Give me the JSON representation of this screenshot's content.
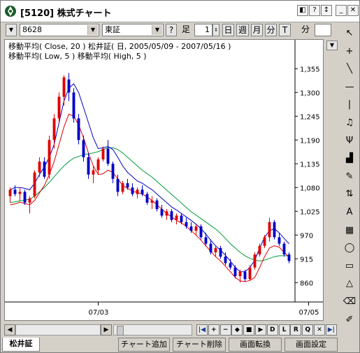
{
  "window": {
    "title": "[5120] 株式チャート"
  },
  "toolbar": {
    "code": "8628",
    "market": "東証",
    "help": "?",
    "period_label": "足",
    "period_value": "1",
    "buttons": [
      "日",
      "週",
      "月",
      "分",
      "T"
    ],
    "minute_label": "分"
  },
  "chart": {
    "legend_line1": "移動平均( Close, 20 )   松井証( 日, 2005/05/09 - 2007/05/16 )",
    "legend_line2": "移動平均( Low, 5 )   移動平均( High, 5 )",
    "colors": {
      "up": "#e00000",
      "down": "#0000c8",
      "ma_close": "#009a3a",
      "ma_low": "#e00000",
      "ma_high": "#0000c8"
    }
  },
  "chart_data": {
    "type": "candlestick",
    "title": "松井証( 日, 2005/05/09 - 2007/05/16 )",
    "yticks": [
      "1,355",
      "1,300",
      "1,245",
      "1,190",
      "1,135",
      "1,080",
      "1,025",
      "970",
      "915",
      "860"
    ],
    "ytick_values": [
      1355,
      1300,
      1245,
      1190,
      1135,
      1080,
      1025,
      970,
      915,
      860
    ],
    "ylim": [
      820,
      1370
    ],
    "xticks": [
      "07/03",
      "07/05"
    ],
    "xtick_index": [
      18,
      61
    ],
    "candles": [
      {
        "o": 1060,
        "h": 1080,
        "l": 1045,
        "c": 1075
      },
      {
        "o": 1075,
        "h": 1085,
        "l": 1060,
        "c": 1065
      },
      {
        "o": 1065,
        "h": 1080,
        "l": 1050,
        "c": 1070
      },
      {
        "o": 1070,
        "h": 1075,
        "l": 1040,
        "c": 1045
      },
      {
        "o": 1045,
        "h": 1060,
        "l": 1020,
        "c": 1055
      },
      {
        "o": 1060,
        "h": 1120,
        "l": 1055,
        "c": 1115
      },
      {
        "o": 1115,
        "h": 1150,
        "l": 1105,
        "c": 1140
      },
      {
        "o": 1140,
        "h": 1150,
        "l": 1100,
        "c": 1105
      },
      {
        "o": 1110,
        "h": 1200,
        "l": 1100,
        "c": 1190
      },
      {
        "o": 1190,
        "h": 1250,
        "l": 1170,
        "c": 1240
      },
      {
        "o": 1240,
        "h": 1300,
        "l": 1230,
        "c": 1290
      },
      {
        "o": 1290,
        "h": 1340,
        "l": 1270,
        "c": 1335
      },
      {
        "o": 1330,
        "h": 1345,
        "l": 1280,
        "c": 1300
      },
      {
        "o": 1300,
        "h": 1310,
        "l": 1230,
        "c": 1240
      },
      {
        "o": 1240,
        "h": 1250,
        "l": 1180,
        "c": 1190
      },
      {
        "o": 1190,
        "h": 1200,
        "l": 1140,
        "c": 1150
      },
      {
        "o": 1150,
        "h": 1160,
        "l": 1100,
        "c": 1110
      },
      {
        "o": 1110,
        "h": 1130,
        "l": 1090,
        "c": 1120
      },
      {
        "o": 1120,
        "h": 1150,
        "l": 1110,
        "c": 1145
      },
      {
        "o": 1145,
        "h": 1175,
        "l": 1140,
        "c": 1170
      },
      {
        "o": 1170,
        "h": 1190,
        "l": 1130,
        "c": 1135
      },
      {
        "o": 1135,
        "h": 1140,
        "l": 1090,
        "c": 1100
      },
      {
        "o": 1100,
        "h": 1110,
        "l": 1060,
        "c": 1070
      },
      {
        "o": 1070,
        "h": 1095,
        "l": 1065,
        "c": 1090
      },
      {
        "o": 1090,
        "h": 1100,
        "l": 1075,
        "c": 1080
      },
      {
        "o": 1080,
        "h": 1090,
        "l": 1060,
        "c": 1065
      },
      {
        "o": 1065,
        "h": 1080,
        "l": 1055,
        "c": 1075
      },
      {
        "o": 1075,
        "h": 1085,
        "l": 1060,
        "c": 1065
      },
      {
        "o": 1065,
        "h": 1070,
        "l": 1040,
        "c": 1045
      },
      {
        "o": 1045,
        "h": 1060,
        "l": 1030,
        "c": 1050
      },
      {
        "o": 1050,
        "h": 1055,
        "l": 1025,
        "c": 1030
      },
      {
        "o": 1030,
        "h": 1040,
        "l": 1010,
        "c": 1015
      },
      {
        "o": 1015,
        "h": 1030,
        "l": 1005,
        "c": 1025
      },
      {
        "o": 1025,
        "h": 1030,
        "l": 1000,
        "c": 1005
      },
      {
        "o": 1005,
        "h": 1020,
        "l": 995,
        "c": 1015
      },
      {
        "o": 1015,
        "h": 1020,
        "l": 995,
        "c": 1000
      },
      {
        "o": 1000,
        "h": 1010,
        "l": 985,
        "c": 990
      },
      {
        "o": 990,
        "h": 1000,
        "l": 975,
        "c": 980
      },
      {
        "o": 980,
        "h": 995,
        "l": 970,
        "c": 990
      },
      {
        "o": 990,
        "h": 995,
        "l": 960,
        "c": 965
      },
      {
        "o": 965,
        "h": 975,
        "l": 945,
        "c": 950
      },
      {
        "o": 950,
        "h": 960,
        "l": 925,
        "c": 930
      },
      {
        "o": 930,
        "h": 945,
        "l": 920,
        "c": 940
      },
      {
        "o": 940,
        "h": 945,
        "l": 915,
        "c": 920
      },
      {
        "o": 920,
        "h": 930,
        "l": 900,
        "c": 905
      },
      {
        "o": 905,
        "h": 915,
        "l": 890,
        "c": 895
      },
      {
        "o": 895,
        "h": 900,
        "l": 870,
        "c": 875
      },
      {
        "o": 875,
        "h": 890,
        "l": 860,
        "c": 885
      },
      {
        "o": 885,
        "h": 890,
        "l": 862,
        "c": 868
      },
      {
        "o": 868,
        "h": 900,
        "l": 865,
        "c": 895
      },
      {
        "o": 895,
        "h": 930,
        "l": 890,
        "c": 925
      },
      {
        "o": 925,
        "h": 950,
        "l": 920,
        "c": 945
      },
      {
        "o": 945,
        "h": 970,
        "l": 940,
        "c": 965
      },
      {
        "o": 965,
        "h": 1010,
        "l": 955,
        "c": 1000
      },
      {
        "o": 1000,
        "h": 1005,
        "l": 960,
        "c": 965
      },
      {
        "o": 965,
        "h": 975,
        "l": 945,
        "c": 950
      },
      {
        "o": 950,
        "h": 955,
        "l": 920,
        "c": 925
      },
      {
        "o": 925,
        "h": 930,
        "l": 905,
        "c": 910
      }
    ],
    "ma_close20": [
      1045,
      1047,
      1049,
      1051,
      1053,
      1060,
      1070,
      1080,
      1092,
      1105,
      1118,
      1130,
      1140,
      1148,
      1152,
      1156,
      1158,
      1160,
      1163,
      1168,
      1172,
      1172,
      1168,
      1160,
      1150,
      1140,
      1130,
      1120,
      1112,
      1104,
      1094,
      1084,
      1074,
      1064,
      1054,
      1044,
      1034,
      1024,
      1016,
      1008,
      1000,
      992,
      984,
      974,
      962,
      950,
      940,
      930,
      922,
      916,
      912,
      910,
      912,
      916,
      920,
      922,
      922,
      922
    ],
    "ma_low5": [
      1040,
      1042,
      1046,
      1043,
      1040,
      1050,
      1068,
      1085,
      1110,
      1140,
      1180,
      1220,
      1250,
      1245,
      1225,
      1195,
      1160,
      1130,
      1110,
      1112,
      1120,
      1115,
      1100,
      1085,
      1078,
      1072,
      1068,
      1065,
      1058,
      1050,
      1040,
      1030,
      1020,
      1012,
      1004,
      998,
      990,
      980,
      970,
      958,
      945,
      932,
      920,
      910,
      898,
      885,
      872,
      864,
      862,
      865,
      872,
      895,
      920,
      940,
      945,
      942,
      930,
      918
    ],
    "ma_high5": [
      1075,
      1080,
      1080,
      1078,
      1075,
      1090,
      1110,
      1128,
      1150,
      1180,
      1230,
      1280,
      1310,
      1320,
      1300,
      1265,
      1230,
      1195,
      1170,
      1172,
      1175,
      1168,
      1150,
      1130,
      1115,
      1105,
      1095,
      1090,
      1082,
      1075,
      1065,
      1055,
      1045,
      1035,
      1028,
      1020,
      1012,
      1004,
      995,
      985,
      972,
      958,
      945,
      935,
      923,
      910,
      895,
      885,
      885,
      895,
      912,
      940,
      965,
      980,
      985,
      975,
      962,
      950
    ]
  },
  "side_tools": [
    "cursor-icon",
    "crosshair-icon",
    "trendline-icon",
    "hline-icon",
    "vline-icon",
    "bell-icon",
    "fork-icon",
    "bar-icon",
    "note-icon",
    "channel-icon",
    "text-icon",
    "table-icon",
    "ellipse-icon",
    "rectangle-icon",
    "triangle-icon",
    "eraser-icon",
    "brush-icon"
  ],
  "nav_buttons": [
    "|◀",
    "+",
    "−",
    "◆",
    "■",
    "▶",
    "D",
    "L",
    "R",
    "Q",
    "✕",
    "▶|"
  ],
  "tabs": {
    "active": "松井証",
    "items": [
      "チャート追加",
      "チャート削除",
      "画面転換",
      "画面設定"
    ]
  }
}
